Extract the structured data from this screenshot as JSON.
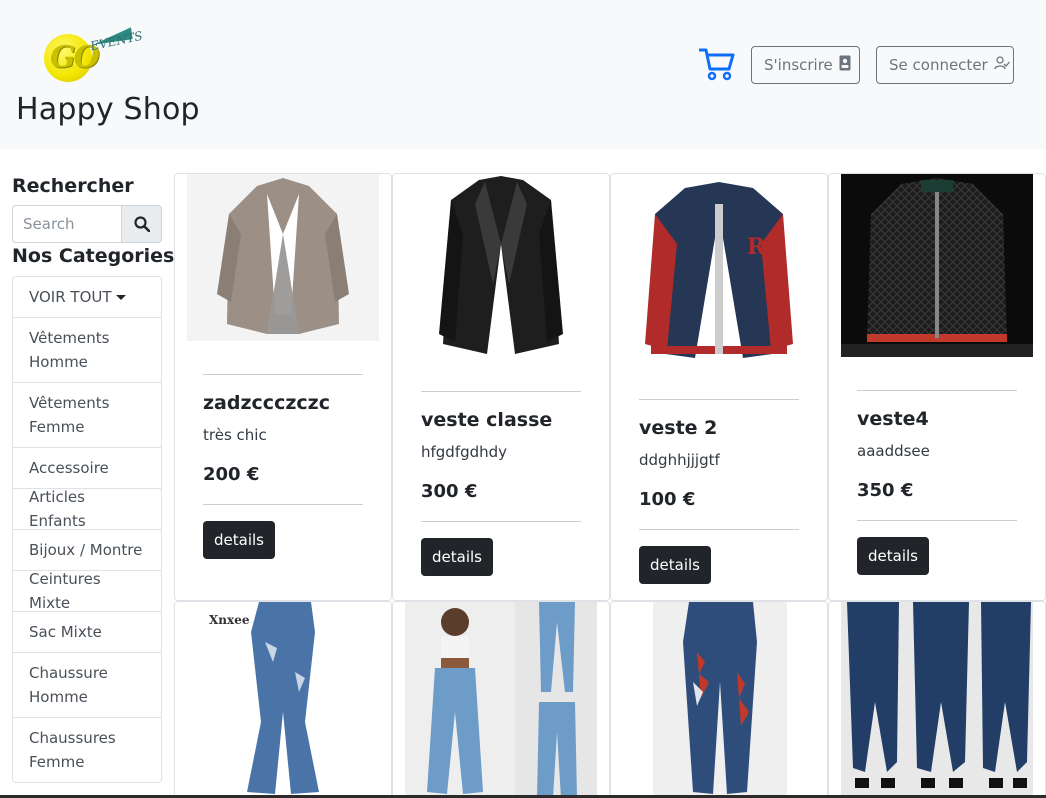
{
  "header": {
    "brand": "Happy Shop",
    "logo_text_main": "GO",
    "logo_text_sub": "EVENTS",
    "cart_icon": "cart-icon",
    "signup_label": "S'inscrire",
    "login_label": "Se connecter",
    "accent_color": "#0d6efd"
  },
  "sidebar": {
    "search_title": "Rechercher",
    "search_placeholder": "Search",
    "categories_title": "Nos Categories",
    "see_all_label": "VOIR TOUT",
    "categories": [
      "Vêtements Homme",
      "Vêtements Femme",
      "Accessoire",
      "Articles Enfants",
      "Bijoux / Montre",
      "Ceintures Mixte",
      "Sac Mixte",
      "Chaussure Homme",
      "Chaussures Femme"
    ]
  },
  "products": [
    {
      "title": "zadzccczczc",
      "description": "très chic",
      "price": "200 €",
      "button": "details",
      "image": "grey-blazer"
    },
    {
      "title": "veste classe",
      "description": "hfgdfgdhdy",
      "price": "300 €",
      "button": "details",
      "image": "black-blazer"
    },
    {
      "title": "veste 2",
      "description": "ddghhjjjgtf",
      "price": "100 €",
      "button": "details",
      "image": "varsity-jacket"
    },
    {
      "title": "veste4",
      "description": "aaaddsee",
      "price": "350 €",
      "button": "details",
      "image": "quilted-jacket"
    }
  ],
  "products_row2": [
    {
      "image": "flare-jeans",
      "label": "Xnxee"
    },
    {
      "image": "flare-jeans-model"
    },
    {
      "image": "embroidered-jeans"
    },
    {
      "image": "skinny-jeans-models"
    }
  ]
}
